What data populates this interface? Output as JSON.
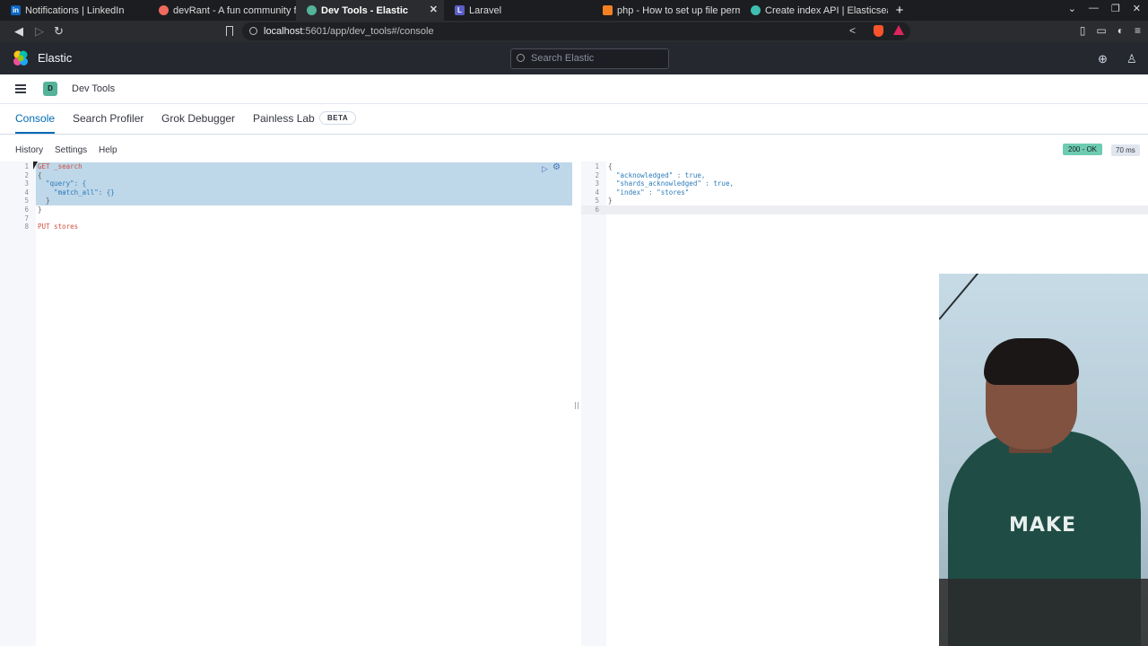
{
  "browser": {
    "tabs": [
      {
        "title": "Notifications | LinkedIn",
        "fav": "in",
        "color": "#0a66c2",
        "active": false
      },
      {
        "title": "devRant - A fun community fo",
        "fav": "",
        "color": "#f26a5d",
        "active": false
      },
      {
        "title": "Dev Tools - Elastic",
        "fav": "",
        "color": "#54b399",
        "active": true
      },
      {
        "title": "Laravel",
        "fav": "L",
        "color": "#5b5fc7",
        "active": false
      },
      {
        "title": "php - How to set up file perm",
        "fav": "",
        "color": "#f48024",
        "active": false
      },
      {
        "title": "Create index API | Elasticsear",
        "fav": "",
        "color": "#3ebeb0",
        "active": false
      }
    ],
    "url_host": "localhost",
    "url_rest": ":5601/app/dev_tools#/console"
  },
  "header": {
    "app_name": "Elastic",
    "search_placeholder": "Search Elastic"
  },
  "breadcrumb": {
    "space_initial": "D",
    "title": "Dev Tools"
  },
  "devtools_tabs": [
    "Console",
    "Search Profiler",
    "Grok Debugger",
    "Painless Lab"
  ],
  "beta_label": "BETA",
  "console_toolbar": {
    "history": "History",
    "settings": "Settings",
    "help": "Help"
  },
  "status": {
    "code": "200 - OK",
    "time": "70 ms"
  },
  "request_lines": [
    {
      "n": "1",
      "text": "GET _search"
    },
    {
      "n": "2",
      "text": "{"
    },
    {
      "n": "3",
      "text": "  \"query\": {"
    },
    {
      "n": "4",
      "text": "    \"match_all\": {}"
    },
    {
      "n": "5",
      "text": "  }"
    },
    {
      "n": "6",
      "text": "}"
    },
    {
      "n": "7",
      "text": ""
    },
    {
      "n": "8",
      "text": "PUT stores"
    }
  ],
  "response_lines": [
    {
      "n": "1",
      "text": "{"
    },
    {
      "n": "2",
      "text": "  \"acknowledged\" : true,"
    },
    {
      "n": "3",
      "text": "  \"shards_acknowledged\" : true,"
    },
    {
      "n": "4",
      "text": "  \"index\" : \"stores\""
    },
    {
      "n": "5",
      "text": "}"
    },
    {
      "n": "6",
      "text": ""
    }
  ],
  "webcam_shirt_text": "MAKE"
}
